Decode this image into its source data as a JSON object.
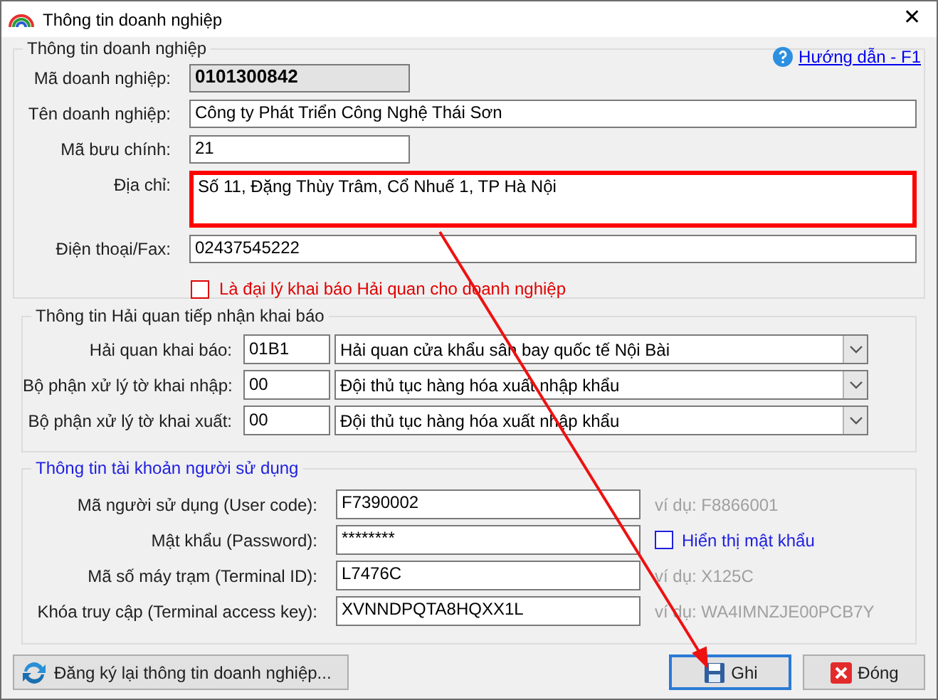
{
  "window": {
    "title": "Thông tin doanh nghiệp",
    "close": "✕"
  },
  "business_section": {
    "title": "Thông tin doanh nghiệp",
    "help_link": "Hướng dẫn - F1",
    "fields": [
      {
        "label": "Mã doanh nghiệp:",
        "value": "0101300842",
        "kind": "readonly",
        "highlighted": false
      },
      {
        "label": "Tên doanh nghiệp:",
        "value": "Công ty Phát Triển Công Nghệ Thái Sơn",
        "kind": "wide",
        "highlighted": false
      },
      {
        "label": "Mã bưu chính:",
        "value": "21",
        "kind": "short",
        "highlighted": false
      },
      {
        "label": "Địa chỉ:",
        "value": "Số 11, Đặng Thùy Trâm, Cổ Nhuế 1, TP Hà Nội",
        "kind": "multiline",
        "highlighted": true
      },
      {
        "label": "Điện thoại/Fax:",
        "value": "02437545222",
        "kind": "wide",
        "highlighted": false
      }
    ],
    "agent_checkbox": {
      "label": "Là đại lý khai báo Hải quan cho doanh nghiệp",
      "checked": false
    }
  },
  "customs_section": {
    "title": "Thông tin Hải quan tiếp nhận khai báo",
    "rows": [
      {
        "label": "Hải quan khai báo:",
        "code": "01B1",
        "name": "Hải quan cửa khẩu sân bay quốc tế Nội Bài"
      },
      {
        "label": "Bộ phận xử lý tờ khai nhập:",
        "code": "00",
        "name": "Đội thủ tục hàng hóa xuất nhập khẩu"
      },
      {
        "label": "Bộ phận xử lý tờ khai xuất:",
        "code": "00",
        "name": "Đội thủ tục hàng hóa xuất nhập khẩu"
      }
    ]
  },
  "account_section": {
    "title": "Thông tin tài khoản người sử dụng",
    "fields": [
      {
        "label": "Mã người sử dụng (User code):",
        "value": "F7390002",
        "hint": "ví dụ: F8866001"
      },
      {
        "label": "Mật khẩu (Password):",
        "value": "********",
        "checkbox": {
          "label": "Hiển thị mật khẩu",
          "checked": false
        }
      },
      {
        "label": "Mã số máy trạm (Terminal ID):",
        "value": "L7476C",
        "hint": "ví dụ: X125C"
      },
      {
        "label": "Khóa truy cập (Terminal access key):",
        "value": "XVNNDPQTA8HQXX1L",
        "hint": "ví dụ: WA4IMNZJE00PCB7Y"
      }
    ]
  },
  "buttons": [
    {
      "label": "Đăng ký lại thông tin doanh nghiệp...",
      "kind": "refresh",
      "selected": false
    },
    {
      "label": "Ghi",
      "kind": "save",
      "selected": true
    },
    {
      "label": "Đóng",
      "kind": "close",
      "selected": false
    }
  ]
}
